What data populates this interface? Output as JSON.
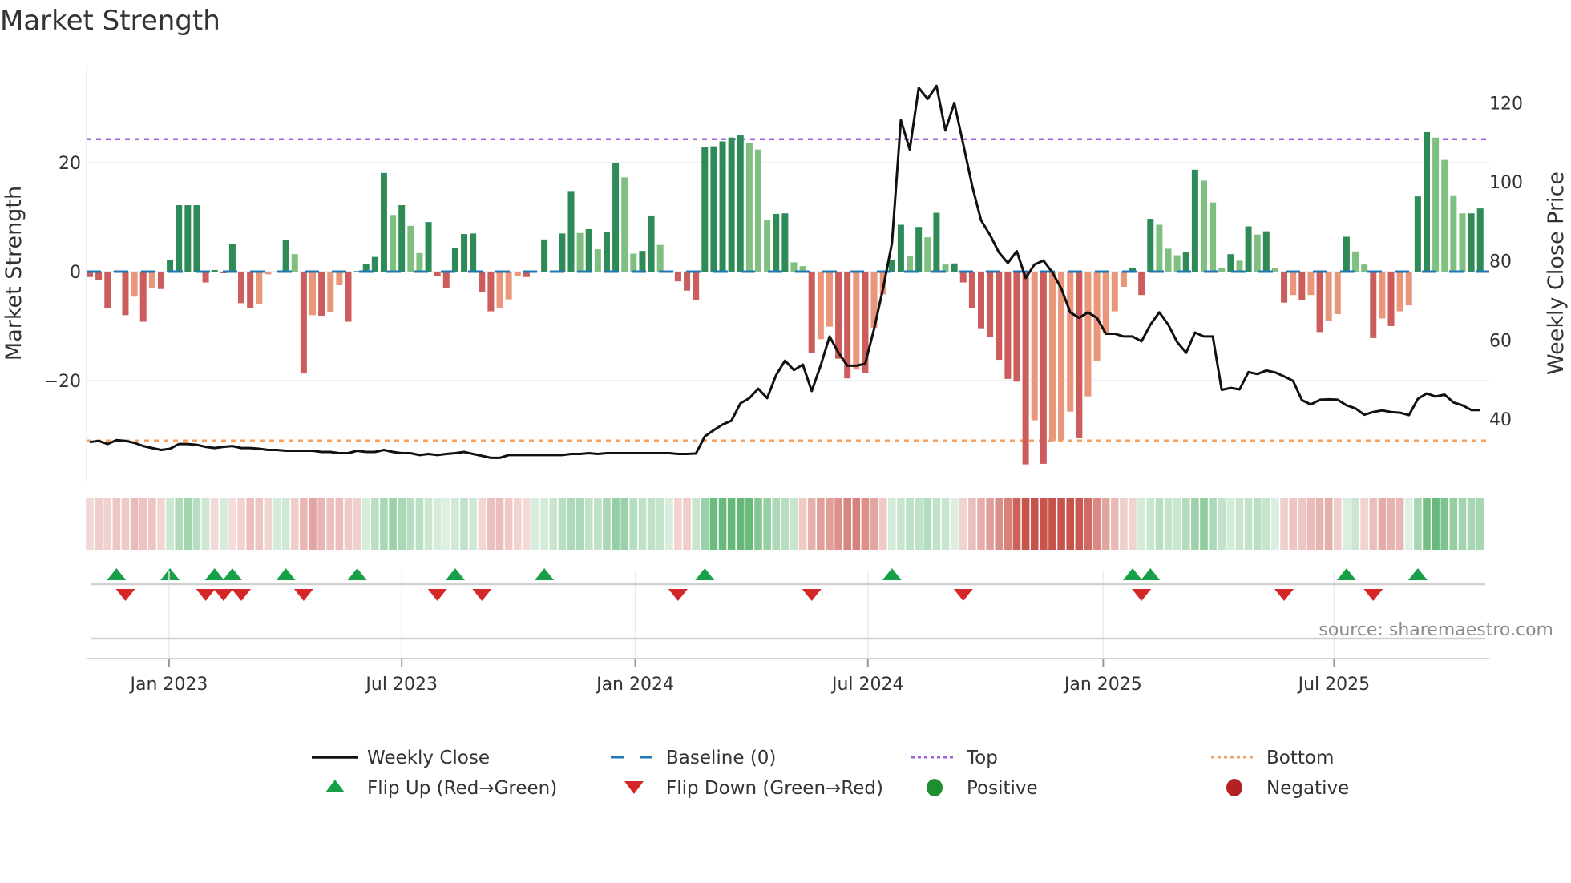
{
  "title": "Market Strength",
  "source": "source: sharemaestro.com",
  "colors": {
    "pos_up": "#2e8b57",
    "pos_down": "#7fbf7f",
    "neg_down": "#cd5c5c",
    "neg_up": "#e9967a",
    "baseline": "#1f77b4",
    "top": "#a064dc",
    "bottom": "#f4a261",
    "price": "#111111",
    "flip_up": "#18a048",
    "flip_down": "#d62728",
    "positive": "#1e8f2e",
    "negative": "#b22222"
  },
  "chart_data": {
    "type": "bar+line",
    "title": "Market Strength",
    "ylabel_left": "Market Strength",
    "ylabel_right": "Weekly Close Price",
    "ylim_left": [
      -38.4,
      37.8
    ],
    "ylim_right": [
      24.4,
      129.4
    ],
    "yticks_left": [
      {
        "v": 20,
        "label": "20"
      },
      {
        "v": 0,
        "label": "0"
      },
      {
        "v": -20,
        "label": "−20"
      }
    ],
    "yticks_right": [
      {
        "v": 40,
        "label": "40"
      },
      {
        "v": 60,
        "label": "60"
      },
      {
        "v": 80,
        "label": "80"
      },
      {
        "v": 100,
        "label": "100"
      },
      {
        "v": 120,
        "label": "120"
      }
    ],
    "x_unit": "week index (weekly, starting ~late Oct 2022)",
    "xticks": [
      {
        "week": 8.9,
        "label": "Jan 2023"
      },
      {
        "week": 35.0,
        "label": "Jul 2023"
      },
      {
        "week": 61.2,
        "label": "Jan 2024"
      },
      {
        "week": 87.3,
        "label": "Jul 2024"
      },
      {
        "week": 113.7,
        "label": "Jan 2025"
      },
      {
        "week": 139.6,
        "label": "Jul 2025"
      }
    ],
    "top_level": 24.3,
    "bottom_level": -31.0,
    "baseline": 0,
    "strength": [
      -1,
      -1.5,
      -6.7,
      0.1,
      -8,
      -4.6,
      -9.2,
      -3,
      -3.2,
      2.1,
      12.2,
      12.2,
      12.2,
      -2,
      0.3,
      -0.3,
      5,
      -5.8,
      -6.7,
      -5.9,
      -0.5,
      0,
      5.8,
      3.2,
      -18.7,
      -8,
      -8.1,
      -7.5,
      -2.5,
      -9.2,
      0.1,
      1.4,
      2.7,
      18.1,
      10.4,
      12.2,
      8.4,
      3.4,
      9.1,
      -0.9,
      -3,
      4.4,
      6.9,
      7,
      -3.7,
      -7.3,
      -6.7,
      -5.1,
      -0.8,
      -1,
      0,
      5.9,
      0.1,
      7,
      14.8,
      7.1,
      7.8,
      4.1,
      7.3,
      19.9,
      17.3,
      3.3,
      3.8,
      10.3,
      4.9,
      0,
      -1.8,
      -3.5,
      -5.3,
      22.8,
      23,
      23.9,
      24.6,
      25,
      23.6,
      22.4,
      9.4,
      10.6,
      10.7,
      1.7,
      1,
      -15,
      -12.4,
      -10.1,
      -16,
      -19.6,
      -18,
      -18.6,
      -10.3,
      -4.2,
      2.2,
      8.6,
      2.9,
      8.2,
      6.3,
      10.8,
      1.3,
      1.5,
      -2,
      -6.7,
      -10.4,
      -12,
      -16.2,
      -19.7,
      -20.2,
      -35.4,
      -27.3,
      -35.3,
      -31.1,
      -31,
      -25.7,
      -30.6,
      -22.9,
      -16.4,
      -11.4,
      -7.3,
      -2.8,
      0.7,
      -4.3,
      9.7,
      8.6,
      4.2,
      3,
      3.6,
      18.7,
      16.7,
      12.7,
      0.6,
      3.2,
      2,
      8.3,
      6.8,
      7.4,
      0.7,
      -5.7,
      -4.3,
      -5.3,
      -4.3,
      -11.1,
      -9.1,
      -7.8,
      6.4,
      3.7,
      1.3,
      -12.2,
      -8.6,
      -10,
      -7.3,
      -6.2,
      13.8,
      25.6,
      24.6,
      20.5,
      14,
      10.7,
      10.7,
      11.6
    ],
    "weekly_close": [
      34.2,
      34.5,
      33.7,
      34.7,
      34.5,
      34.0,
      33.2,
      32.7,
      32.2,
      32.5,
      33.7,
      33.7,
      33.5,
      33.0,
      32.7,
      33.0,
      33.2,
      32.7,
      32.7,
      32.5,
      32.2,
      32.2,
      32.0,
      32.0,
      32.0,
      32.0,
      31.7,
      31.7,
      31.4,
      31.4,
      32.0,
      31.7,
      31.7,
      32.2,
      31.7,
      31.4,
      31.4,
      30.9,
      31.2,
      30.9,
      31.2,
      31.4,
      31.7,
      31.2,
      30.7,
      30.2,
      30.2,
      30.9,
      30.9,
      30.9,
      30.9,
      30.9,
      30.9,
      30.9,
      31.2,
      31.2,
      31.4,
      31.2,
      31.4,
      31.4,
      31.4,
      31.4,
      31.4,
      31.4,
      31.4,
      31.4,
      31.2,
      31.2,
      31.3,
      35.6,
      37.2,
      38.6,
      39.6,
      44.0,
      45.3,
      47.7,
      45.3,
      51.1,
      54.8,
      52.4,
      53.8,
      47.1,
      53.5,
      60.9,
      56.8,
      53.5,
      53.5,
      54.0,
      62.9,
      73.0,
      84.5,
      115.6,
      108.2,
      123.8,
      121.0,
      124.3,
      113.0,
      120.0,
      109.5,
      99.0,
      90.3,
      86.6,
      82.2,
      79.5,
      82.5,
      75.7,
      79.1,
      80.1,
      77.1,
      73.0,
      67.0,
      65.6,
      67.0,
      65.6,
      61.6,
      61.6,
      60.9,
      60.9,
      59.7,
      63.9,
      67.0,
      63.9,
      59.5,
      56.8,
      61.9,
      60.9,
      60.9,
      47.4,
      47.9,
      47.5,
      51.9,
      51.4,
      52.3,
      51.8,
      50.8,
      49.7,
      44.8,
      43.7,
      44.9,
      45.0,
      44.9,
      43.5,
      42.7,
      41.1,
      41.8,
      42.2,
      41.8,
      41.6,
      41.0,
      45.1,
      46.5,
      45.7,
      46.2,
      44.2,
      43.5,
      42.3,
      42.3
    ],
    "flip_up_weeks": [
      3,
      9,
      14,
      16,
      22,
      30,
      41,
      51,
      69,
      90,
      117,
      119,
      141,
      149
    ],
    "flip_down_weeks": [
      4,
      13,
      15,
      17,
      24,
      39,
      44,
      66,
      81,
      98,
      118,
      134,
      144
    ]
  },
  "legend": [
    {
      "key": "weekly_close",
      "label": "Weekly Close",
      "symbol": "line"
    },
    {
      "key": "baseline",
      "label": "Baseline (0)",
      "symbol": "dash"
    },
    {
      "key": "top",
      "label": "Top",
      "symbol": "dot"
    },
    {
      "key": "bottom",
      "label": "Bottom",
      "symbol": "dot"
    },
    {
      "key": "flip_up",
      "label": "Flip Up (Red→Green)",
      "symbol": "tri-up"
    },
    {
      "key": "flip_down",
      "label": "Flip Down (Green→Red)",
      "symbol": "tri-down"
    },
    {
      "key": "positive",
      "label": "Positive",
      "symbol": "circle"
    },
    {
      "key": "negative",
      "label": "Negative",
      "symbol": "circle"
    }
  ]
}
